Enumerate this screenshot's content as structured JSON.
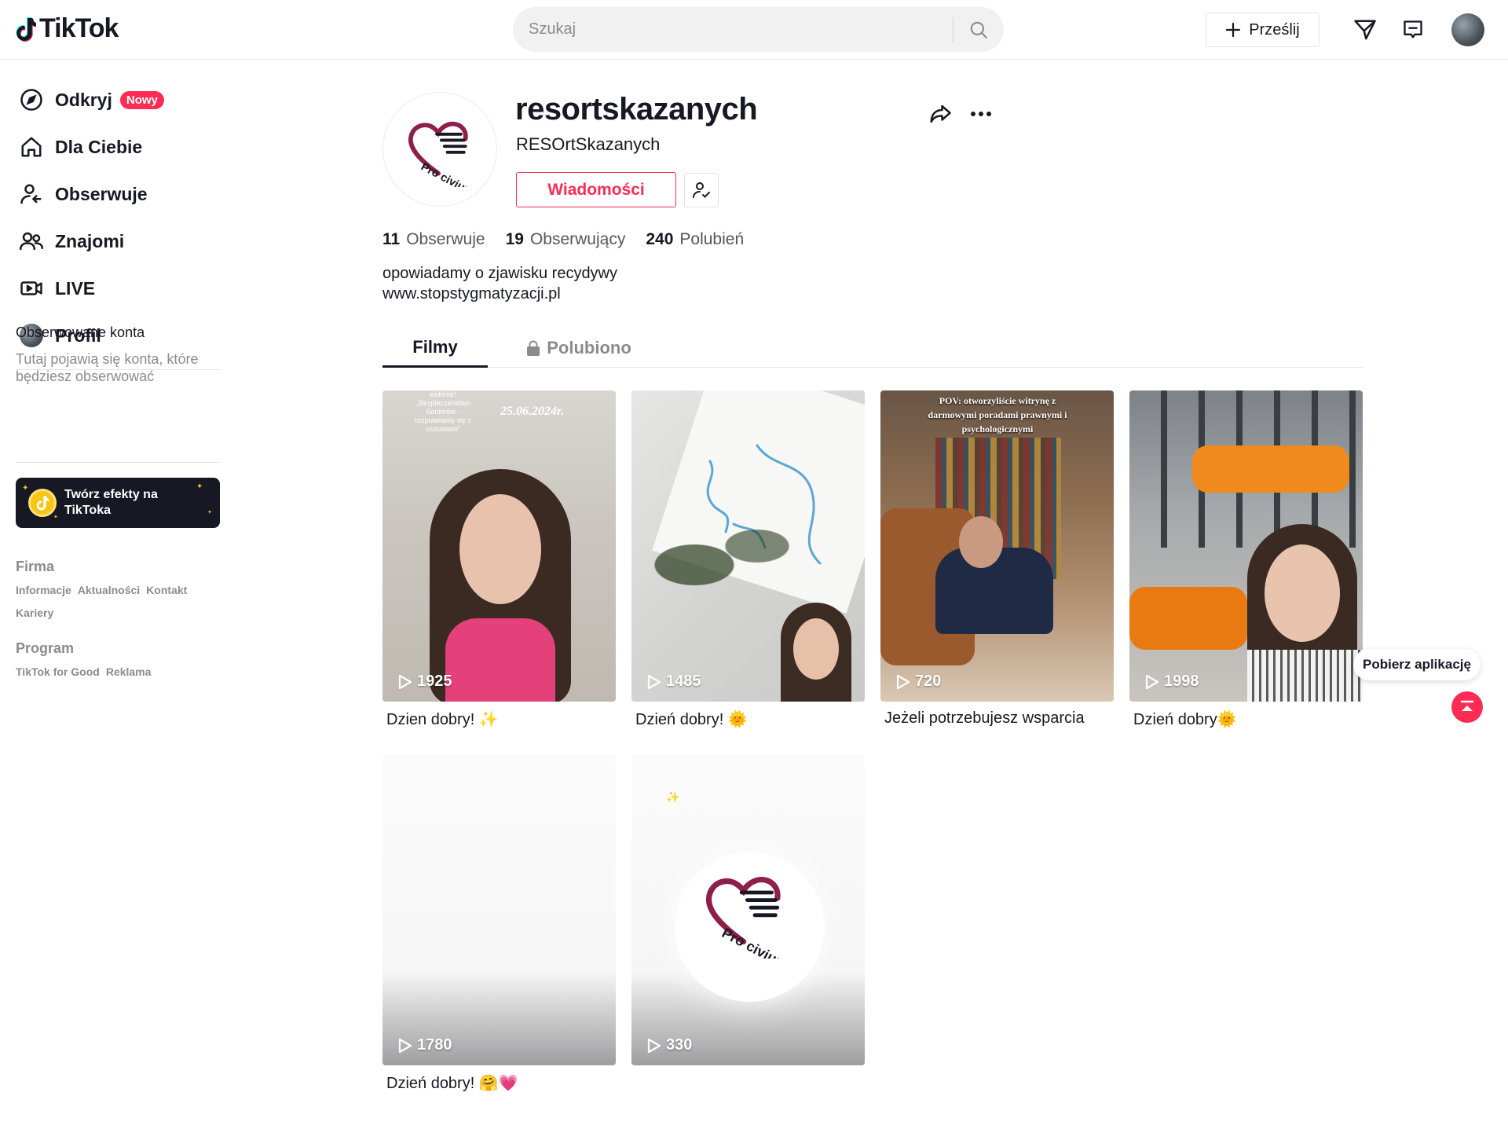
{
  "header": {
    "logo_text": "TikTok",
    "search_placeholder": "Szukaj",
    "upload_label": "Prześlij"
  },
  "sidebar": {
    "nav": [
      {
        "label": "Odkryj",
        "icon": "compass-icon",
        "badge": "Nowy"
      },
      {
        "label": "Dla Ciebie",
        "icon": "home-icon"
      },
      {
        "label": "Obserwuje",
        "icon": "user-follow-icon"
      },
      {
        "label": "Znajomi",
        "icon": "friends-icon"
      },
      {
        "label": "LIVE",
        "icon": "live-camera-icon"
      },
      {
        "label": "Profil",
        "icon": "avatar-icon"
      }
    ],
    "following_title": "Obserwowane konta",
    "following_desc": "Tutaj pojawią się konta, które będziesz obserwować",
    "effects_label": "Twórz efekty na TikToka",
    "footer": {
      "firma_title": "Firma",
      "firma_links": [
        "Informacje",
        "Aktualności",
        "Kontakt",
        "Kariery"
      ],
      "program_title": "Program",
      "program_links": [
        "TikTok for Good",
        "Reklama"
      ]
    }
  },
  "profile": {
    "username": "resortskazanych",
    "nickname": "RESOrtSkazanych",
    "message_button": "Wiadomości",
    "stats": [
      {
        "value": "11",
        "label": "Obserwuje"
      },
      {
        "value": "19",
        "label": "Obserwujący"
      },
      {
        "value": "240",
        "label": "Polubień"
      }
    ],
    "bio_line1": "opowiadamy o zjawisku recydywy",
    "bio_line2": "www.stopstygmatyzacji.pl",
    "avatar_text": "Pro civium"
  },
  "tabs": {
    "videos": "Filmy",
    "liked": "Polubiono"
  },
  "videos": [
    {
      "views": "1925",
      "caption": "Dzien dobry! ✨",
      "overlay_date": "25.06.2024r.",
      "overlay_text": "webinar! „Bezpieczeństwo Seniorów - rozprawiamy się z oszustami”"
    },
    {
      "views": "1485",
      "caption": "Dzień dobry! 🌞"
    },
    {
      "views": "720",
      "caption": "Jeżeli potrzebujesz wsparcia",
      "overlay_text": "POV: otworzyliście witrynę z darmowymi poradami prawnymi i psychologicznymi"
    },
    {
      "views": "1998",
      "caption": "Dzień dobry🌞"
    },
    {
      "views": "1780",
      "caption": "Dzień dobry! 🤗💗"
    },
    {
      "views": "330",
      "caption": "",
      "logo_text": "Pro civium"
    }
  ],
  "floating": {
    "get_app": "Pobierz aplikację"
  },
  "colors": {
    "accent": "#fe2c55",
    "text": "#161823",
    "muted": "#8a8b91"
  }
}
